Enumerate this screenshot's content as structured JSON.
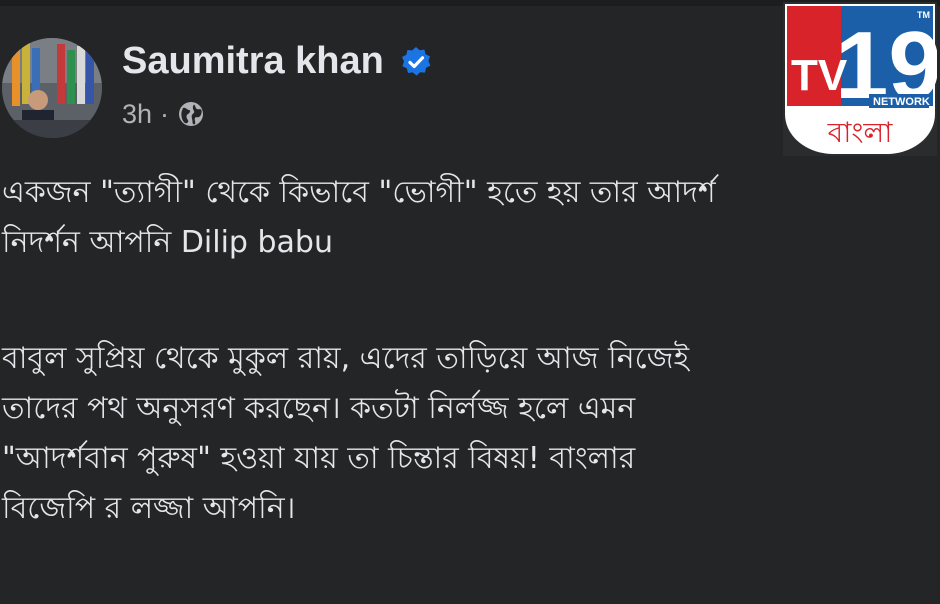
{
  "post": {
    "author": "Saumitra khan",
    "timestamp": "3h",
    "separator": "·",
    "audience_icon": "globe-icon",
    "verified_icon": "verified-badge-icon",
    "paragraphs": [
      "একজন \"ত্যাগী\" থেকে কিভাবে \"ভোগী\" হতে হয় তার আদর্শ\nনিদর্শন আপনি Dilip babu",
      "বাবুল সুপ্রিয় থেকে মুকুল রায়, এদের তাড়িয়ে আজ নিজেই\nতাদের পথ অনুসরণ করছেন। কতটা নির্লজ্জ হলে এমন\n\"আদর্শবান পুরুষ\" হওয়া যায় তা চিন্তার বিষয়!  বাংলার\nবিজেপি র লজ্জা আপনি।"
    ]
  },
  "watermark": {
    "brand_tv": "TV",
    "brand_number": "19",
    "brand_network": "NETWORK",
    "brand_tm": "TM",
    "brand_language": "বাংলা"
  },
  "colors": {
    "background": "#242526",
    "text_primary": "#e4e6eb",
    "text_secondary": "#b0b3b8",
    "verified_blue": "#1b74e4",
    "logo_red": "#d8232a",
    "logo_blue": "#1a5fa8"
  }
}
